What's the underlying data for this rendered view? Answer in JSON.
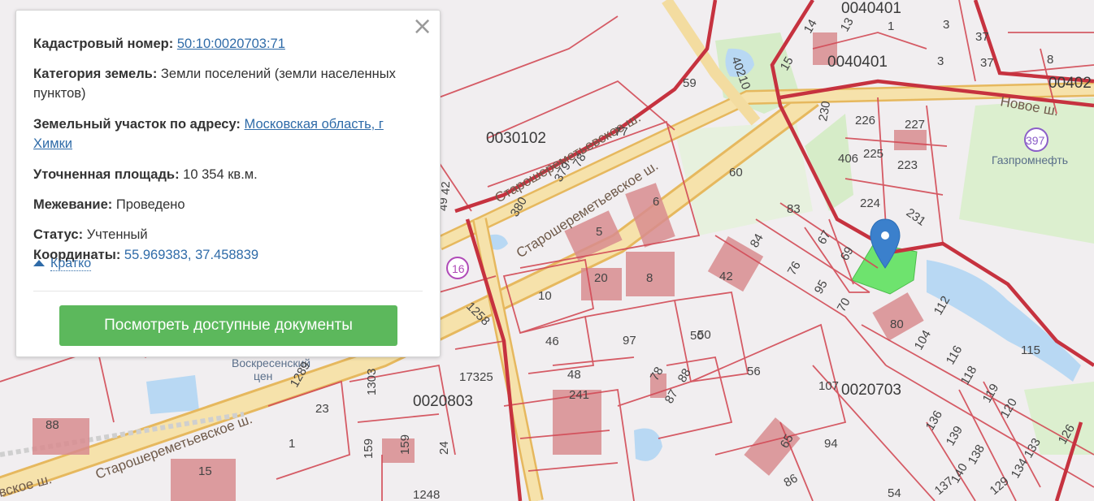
{
  "popup": {
    "cadastral_label": "Кадастровый номер:",
    "cadastral_value": "50:10:0020703:71",
    "category_label": "Категория земель:",
    "category_value": "Земли поселений (земли населенных пунктов)",
    "address_label": "Земельный участок по адресу:",
    "address_value": "Московская область, г Химки",
    "area_label": "Уточненная площадь:",
    "area_value": "10 354 кв.м.",
    "survey_label": "Межевание:",
    "survey_value": "Проведено",
    "status_label": "Статус:",
    "status_value": "Учтенный",
    "coords_label": "Координаты:",
    "coords_value": "55.969383, 37.458839",
    "brief_label": "Кратко",
    "documents_button": "Посмотреть доступные документы",
    "close_icon": "close-icon"
  },
  "map": {
    "quarters": [
      "0030102",
      "0020803",
      "0020703",
      "0040401",
      "0040401",
      "00402"
    ],
    "roads": [
      "Старошереметьевское ш.",
      "Старошереметьевское ш.",
      "Старошереметьевское ш.",
      "Новое ш.",
      "вское ш."
    ],
    "poi": [
      "Газпромнефть",
      "Воскресенский",
      "цен"
    ],
    "shields": [
      "16",
      "397"
    ],
    "parcels": [
      "50",
      "230",
      "226",
      "227",
      "406",
      "225",
      "223",
      "224",
      "231",
      "60",
      "83",
      "67",
      "69",
      "84",
      "76",
      "95",
      "70",
      "42",
      "80",
      "112",
      "104",
      "116",
      "118",
      "119",
      "120",
      "115",
      "59",
      "77",
      "78",
      "379",
      "380",
      "6",
      "5",
      "8",
      "20",
      "10",
      "46",
      "97",
      "50",
      "56",
      "107",
      "94",
      "65",
      "86",
      "54",
      "136",
      "139",
      "138",
      "140",
      "137",
      "129",
      "134",
      "133",
      "126",
      "78",
      "87",
      "88",
      "48",
      "241",
      "17325",
      "1303",
      "159",
      "159",
      "24",
      "1248",
      "1289",
      "1258",
      "23",
      "88",
      "1",
      "15",
      "40210",
      "14",
      "13",
      "1",
      "3",
      "37",
      "37",
      "8",
      "3",
      "15",
      "42",
      "49"
    ],
    "colors": {
      "boundary": "#d24b56",
      "major_boundary": "#c6323f",
      "road": "#f3dca0",
      "road_edge": "#e6b85e",
      "building": "#d98c8f",
      "water": "#b8d8f3",
      "green": "#d6ecc8",
      "selected": "#6ee36e",
      "marker": "#3b80cc"
    }
  }
}
